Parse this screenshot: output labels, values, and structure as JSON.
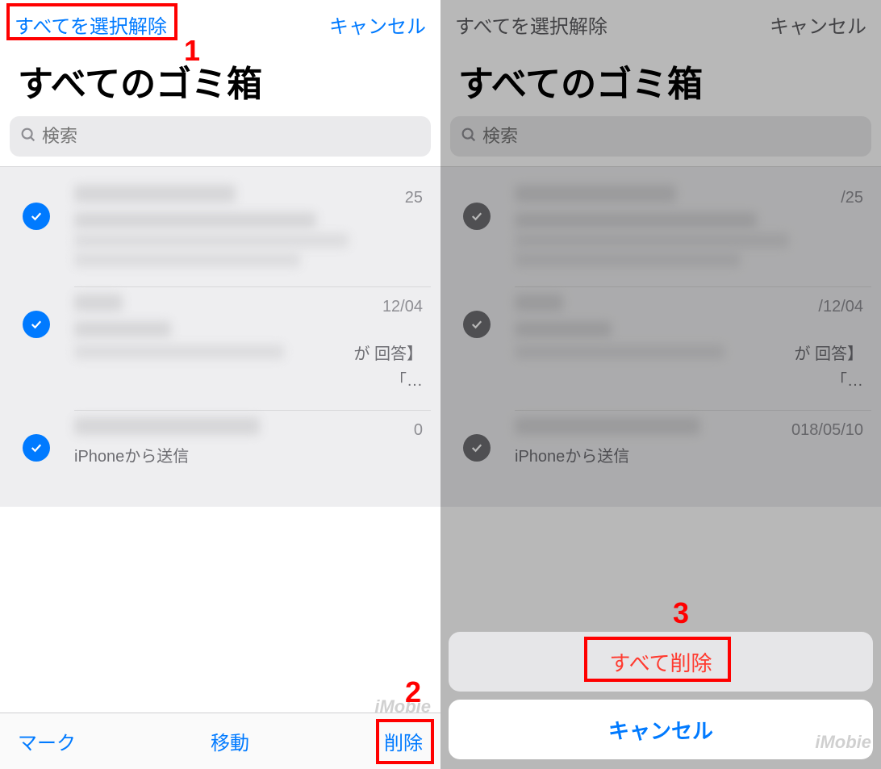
{
  "left": {
    "nav": {
      "select_label": "すべてを選択解除",
      "cancel_label": "キャンセル"
    },
    "title": "すべてのゴミ箱",
    "search_placeholder": "検索",
    "rows": [
      {
        "date": "25",
        "snippet": ""
      },
      {
        "date": "12/04",
        "snippet": "が 回答】",
        "snippet2": "「…"
      },
      {
        "date": "0",
        "snippet_left": "iPhoneから送信"
      }
    ],
    "toolbar": {
      "mark": "マーク",
      "move": "移動",
      "delete": "削除"
    }
  },
  "right": {
    "nav": {
      "select_label": "すべてを選択解除",
      "cancel_label": "キャンセル"
    },
    "title": "すべてのゴミ箱",
    "search_placeholder": "検索",
    "rows": [
      {
        "date": "/25",
        "snippet": ""
      },
      {
        "date": "/12/04",
        "snippet": "が 回答】",
        "snippet2": "「…"
      },
      {
        "date": "018/05/10",
        "snippet_left": "iPhoneから送信"
      }
    ],
    "sheet": {
      "delete_all": "すべて削除",
      "cancel": "キャンセル"
    }
  },
  "annotations": {
    "n1": "1",
    "n2": "2",
    "n3": "3"
  },
  "watermark": "iMobie"
}
